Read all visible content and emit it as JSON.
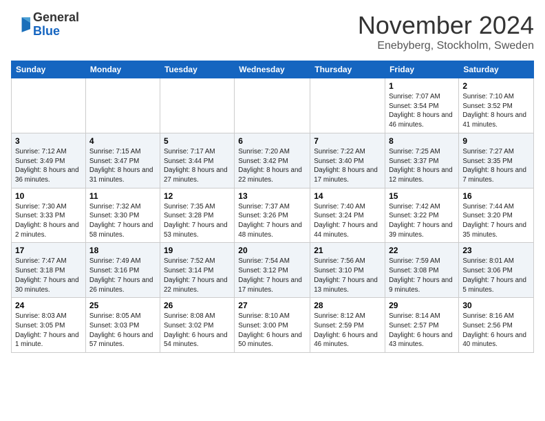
{
  "logo": {
    "text_general": "General",
    "text_blue": "Blue"
  },
  "header": {
    "month": "November 2024",
    "location": "Enebyberg, Stockholm, Sweden"
  },
  "weekdays": [
    "Sunday",
    "Monday",
    "Tuesday",
    "Wednesday",
    "Thursday",
    "Friday",
    "Saturday"
  ],
  "weeks": [
    [
      {
        "day": "",
        "info": ""
      },
      {
        "day": "",
        "info": ""
      },
      {
        "day": "",
        "info": ""
      },
      {
        "day": "",
        "info": ""
      },
      {
        "day": "",
        "info": ""
      },
      {
        "day": "1",
        "info": "Sunrise: 7:07 AM\nSunset: 3:54 PM\nDaylight: 8 hours and 46 minutes."
      },
      {
        "day": "2",
        "info": "Sunrise: 7:10 AM\nSunset: 3:52 PM\nDaylight: 8 hours and 41 minutes."
      }
    ],
    [
      {
        "day": "3",
        "info": "Sunrise: 7:12 AM\nSunset: 3:49 PM\nDaylight: 8 hours and 36 minutes."
      },
      {
        "day": "4",
        "info": "Sunrise: 7:15 AM\nSunset: 3:47 PM\nDaylight: 8 hours and 31 minutes."
      },
      {
        "day": "5",
        "info": "Sunrise: 7:17 AM\nSunset: 3:44 PM\nDaylight: 8 hours and 27 minutes."
      },
      {
        "day": "6",
        "info": "Sunrise: 7:20 AM\nSunset: 3:42 PM\nDaylight: 8 hours and 22 minutes."
      },
      {
        "day": "7",
        "info": "Sunrise: 7:22 AM\nSunset: 3:40 PM\nDaylight: 8 hours and 17 minutes."
      },
      {
        "day": "8",
        "info": "Sunrise: 7:25 AM\nSunset: 3:37 PM\nDaylight: 8 hours and 12 minutes."
      },
      {
        "day": "9",
        "info": "Sunrise: 7:27 AM\nSunset: 3:35 PM\nDaylight: 8 hours and 7 minutes."
      }
    ],
    [
      {
        "day": "10",
        "info": "Sunrise: 7:30 AM\nSunset: 3:33 PM\nDaylight: 8 hours and 2 minutes."
      },
      {
        "day": "11",
        "info": "Sunrise: 7:32 AM\nSunset: 3:30 PM\nDaylight: 7 hours and 58 minutes."
      },
      {
        "day": "12",
        "info": "Sunrise: 7:35 AM\nSunset: 3:28 PM\nDaylight: 7 hours and 53 minutes."
      },
      {
        "day": "13",
        "info": "Sunrise: 7:37 AM\nSunset: 3:26 PM\nDaylight: 7 hours and 48 minutes."
      },
      {
        "day": "14",
        "info": "Sunrise: 7:40 AM\nSunset: 3:24 PM\nDaylight: 7 hours and 44 minutes."
      },
      {
        "day": "15",
        "info": "Sunrise: 7:42 AM\nSunset: 3:22 PM\nDaylight: 7 hours and 39 minutes."
      },
      {
        "day": "16",
        "info": "Sunrise: 7:44 AM\nSunset: 3:20 PM\nDaylight: 7 hours and 35 minutes."
      }
    ],
    [
      {
        "day": "17",
        "info": "Sunrise: 7:47 AM\nSunset: 3:18 PM\nDaylight: 7 hours and 30 minutes."
      },
      {
        "day": "18",
        "info": "Sunrise: 7:49 AM\nSunset: 3:16 PM\nDaylight: 7 hours and 26 minutes."
      },
      {
        "day": "19",
        "info": "Sunrise: 7:52 AM\nSunset: 3:14 PM\nDaylight: 7 hours and 22 minutes."
      },
      {
        "day": "20",
        "info": "Sunrise: 7:54 AM\nSunset: 3:12 PM\nDaylight: 7 hours and 17 minutes."
      },
      {
        "day": "21",
        "info": "Sunrise: 7:56 AM\nSunset: 3:10 PM\nDaylight: 7 hours and 13 minutes."
      },
      {
        "day": "22",
        "info": "Sunrise: 7:59 AM\nSunset: 3:08 PM\nDaylight: 7 hours and 9 minutes."
      },
      {
        "day": "23",
        "info": "Sunrise: 8:01 AM\nSunset: 3:06 PM\nDaylight: 7 hours and 5 minutes."
      }
    ],
    [
      {
        "day": "24",
        "info": "Sunrise: 8:03 AM\nSunset: 3:05 PM\nDaylight: 7 hours and 1 minute."
      },
      {
        "day": "25",
        "info": "Sunrise: 8:05 AM\nSunset: 3:03 PM\nDaylight: 6 hours and 57 minutes."
      },
      {
        "day": "26",
        "info": "Sunrise: 8:08 AM\nSunset: 3:02 PM\nDaylight: 6 hours and 54 minutes."
      },
      {
        "day": "27",
        "info": "Sunrise: 8:10 AM\nSunset: 3:00 PM\nDaylight: 6 hours and 50 minutes."
      },
      {
        "day": "28",
        "info": "Sunrise: 8:12 AM\nSunset: 2:59 PM\nDaylight: 6 hours and 46 minutes."
      },
      {
        "day": "29",
        "info": "Sunrise: 8:14 AM\nSunset: 2:57 PM\nDaylight: 6 hours and 43 minutes."
      },
      {
        "day": "30",
        "info": "Sunrise: 8:16 AM\nSunset: 2:56 PM\nDaylight: 6 hours and 40 minutes."
      }
    ]
  ]
}
